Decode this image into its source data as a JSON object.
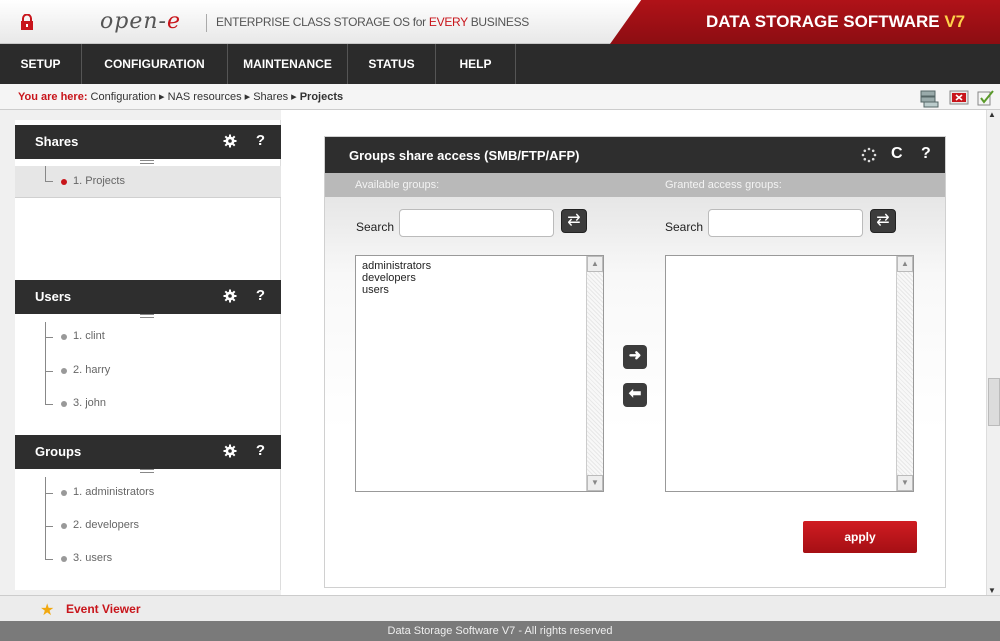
{
  "header": {
    "logo_text": "open-",
    "logo_e": "e",
    "tagline_pre": "ENTERPRISE CLASS STORAGE OS for ",
    "tagline_red": "EVERY",
    "tagline_post": " BUSINESS",
    "brand": "DATA STORAGE SOFTWARE ",
    "brand_version": "V7",
    "brand_color": "#b01218"
  },
  "nav": {
    "items": [
      {
        "label": "SETUP"
      },
      {
        "label": "CONFIGURATION"
      },
      {
        "label": "MAINTENANCE"
      },
      {
        "label": "STATUS"
      },
      {
        "label": "HELP"
      }
    ]
  },
  "breadcrumb": {
    "label": "You are here:",
    "path": " Configuration ▸ NAS resources ▸ Shares ▸ ",
    "current": "Projects"
  },
  "sidebar": {
    "shares": {
      "title": "Shares",
      "items": [
        {
          "label": "1. Projects"
        }
      ]
    },
    "users": {
      "title": "Users",
      "items": [
        {
          "label": "1. clint"
        },
        {
          "label": "2. harry"
        },
        {
          "label": "3. john"
        }
      ]
    },
    "groups": {
      "title": "Groups",
      "items": [
        {
          "label": "1. administrators"
        },
        {
          "label": "2. developers"
        },
        {
          "label": "3. users"
        }
      ]
    },
    "help_glyph": "?"
  },
  "panel": {
    "title": "Groups share access (SMB/FTP/AFP)",
    "available_label": "Available groups:",
    "granted_label": "Granted access groups:",
    "search_label": "Search",
    "available_items": [
      "administrators",
      "developers",
      "users"
    ],
    "granted_items": [],
    "apply_label": "apply",
    "refresh_glyph": "C",
    "help_glyph": "?"
  },
  "footer": {
    "event_viewer": "Event Viewer",
    "copyright": "Data Storage Software V7 - All rights reserved"
  }
}
